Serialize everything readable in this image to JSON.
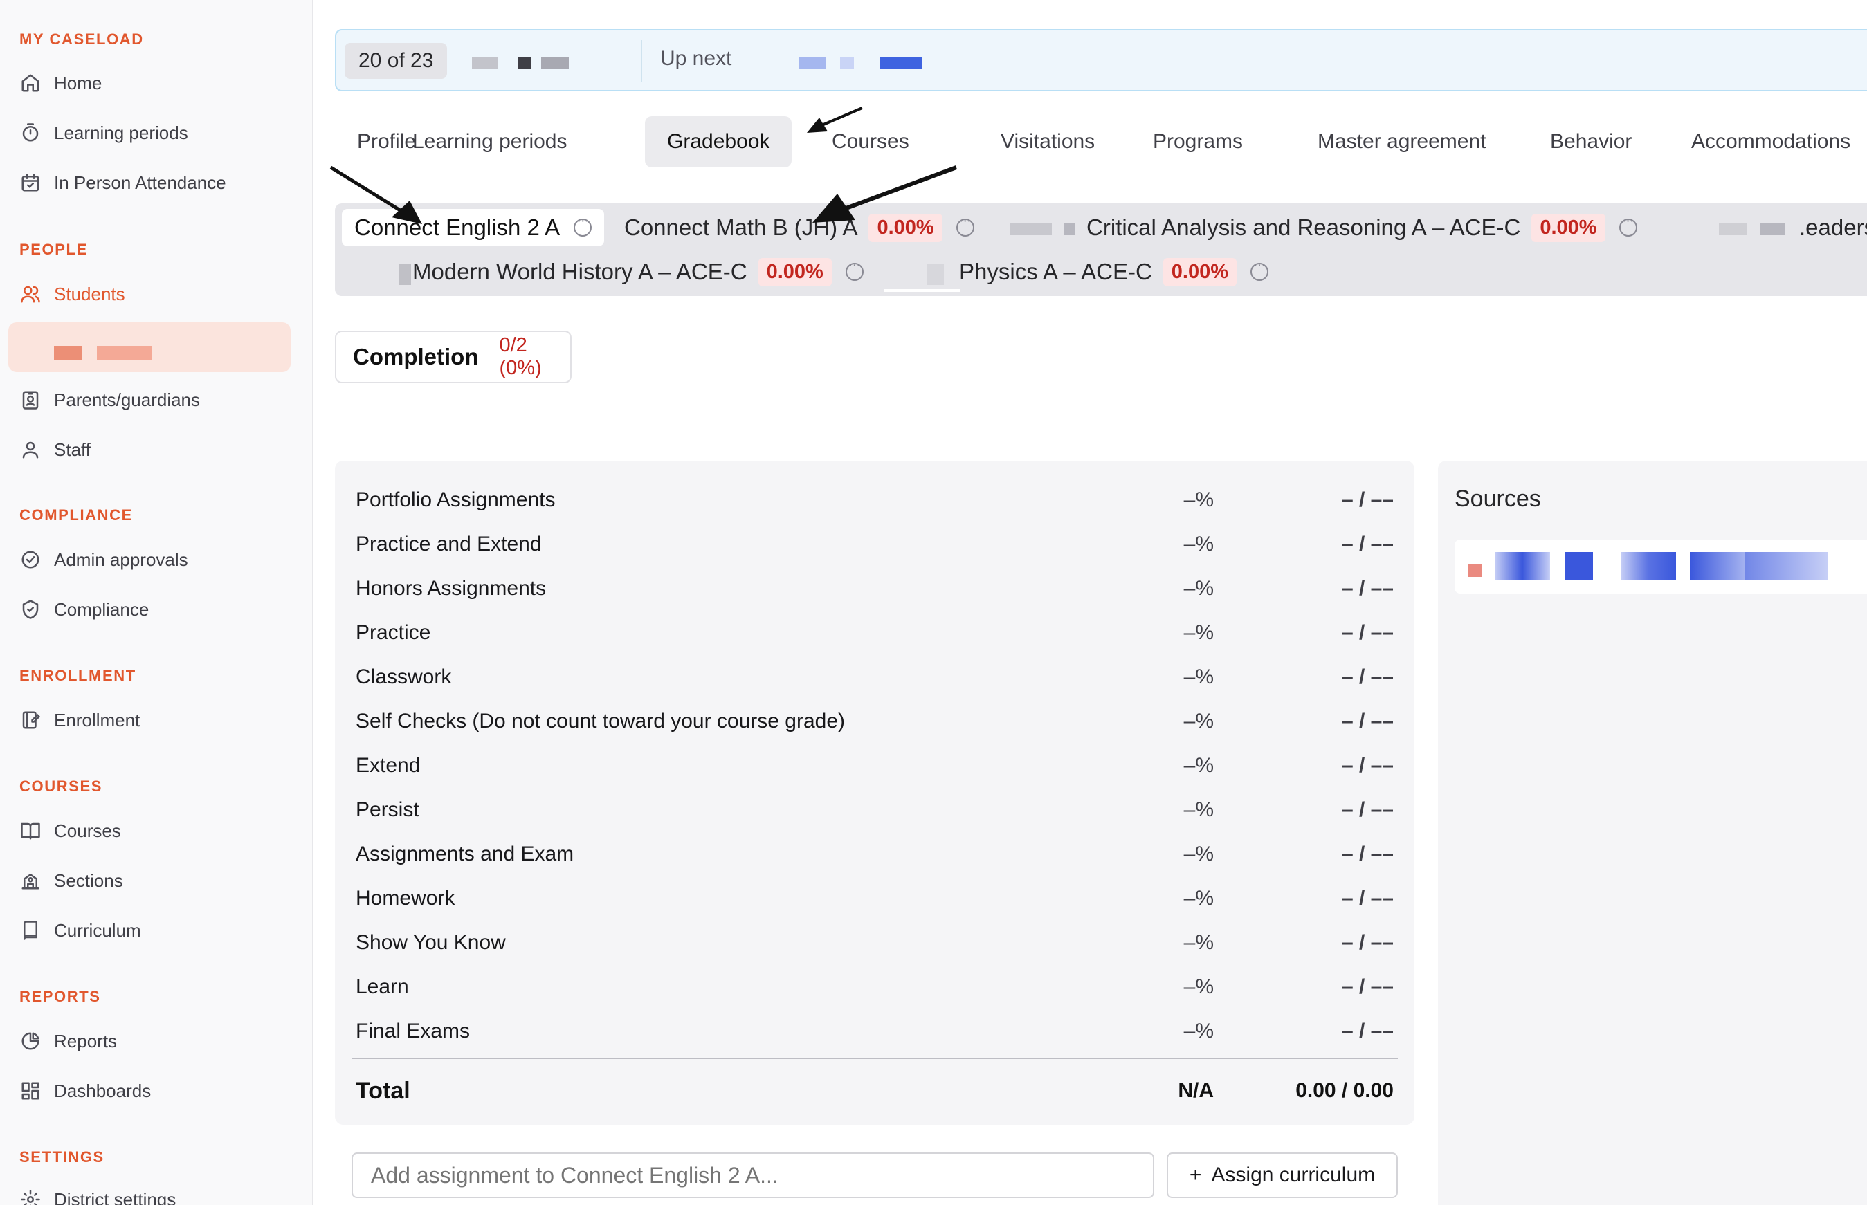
{
  "sidebar": {
    "caseload_heading": "MY CASELOAD",
    "caseload": [
      {
        "label": "Home",
        "icon": "home-icon"
      },
      {
        "label": "Learning periods",
        "icon": "timer-icon"
      },
      {
        "label": "In Person Attendance",
        "icon": "calendar-check-icon"
      }
    ],
    "people_heading": "PEOPLE",
    "people": [
      {
        "label": "Students",
        "icon": "users-icon"
      },
      {
        "label": "Parents/guardians",
        "icon": "id-badge-icon"
      },
      {
        "label": "Staff",
        "icon": "user-icon"
      }
    ],
    "compliance_heading": "COMPLIANCE",
    "compliance": [
      {
        "label": "Admin approvals",
        "icon": "check-circle-icon"
      },
      {
        "label": "Compliance",
        "icon": "shield-check-icon"
      }
    ],
    "enrollment_heading": "ENROLLMENT",
    "enrollment": [
      {
        "label": "Enrollment",
        "icon": "notebook-pen-icon"
      }
    ],
    "courses_heading": "COURSES",
    "courses": [
      {
        "label": "Courses",
        "icon": "book-open-icon"
      },
      {
        "label": "Sections",
        "icon": "school-icon"
      },
      {
        "label": "Curriculum",
        "icon": "book-icon"
      }
    ],
    "reports_heading": "REPORTS",
    "reports": [
      {
        "label": "Reports",
        "icon": "pie-chart-icon"
      },
      {
        "label": "Dashboards",
        "icon": "dashboard-icon"
      }
    ],
    "settings_heading": "SETTINGS",
    "settings": [
      {
        "label": "District settings",
        "icon": "gear-icon"
      }
    ]
  },
  "banner": {
    "counter": "20 of 23",
    "up_next": "Up next"
  },
  "tabs": [
    "Profile",
    "Learning periods",
    "Gradebook",
    "Courses",
    "Visitations",
    "Programs",
    "Master agreement",
    "Behavior",
    "Accommodations"
  ],
  "active_tab": "Gradebook",
  "course_tabs": {
    "active": "Connect English 2 A",
    "math": {
      "name": "Connect Math B (JH) A",
      "pct": "0.00%"
    },
    "critical": {
      "name": "Critical Analysis and Reasoning A – ACE-C",
      "pct": "0.00%"
    },
    "leadership_partial": ".eadersh",
    "history": {
      "name": "Modern World History A – ACE-C",
      "pct": "0.00%"
    },
    "physics": {
      "name": "Physics A – ACE-C",
      "pct": "0.00%"
    }
  },
  "completion": {
    "label": "Completion",
    "value": "0/2 (0%)"
  },
  "gradebook": {
    "rows": [
      {
        "name": "Portfolio Assignments",
        "pct": "–%",
        "score": "– / ––"
      },
      {
        "name": "Practice and Extend",
        "pct": "–%",
        "score": "– / ––"
      },
      {
        "name": "Honors Assignments",
        "pct": "–%",
        "score": "– / ––"
      },
      {
        "name": "Practice",
        "pct": "–%",
        "score": "– / ––"
      },
      {
        "name": "Classwork",
        "pct": "–%",
        "score": "– / ––"
      },
      {
        "name": "Self Checks (Do not count toward your course grade)",
        "pct": "–%",
        "score": "– / ––"
      },
      {
        "name": "Extend",
        "pct": "–%",
        "score": "– / ––"
      },
      {
        "name": "Persist",
        "pct": "–%",
        "score": "– / ––"
      },
      {
        "name": "Assignments and Exam",
        "pct": "–%",
        "score": "– / ––"
      },
      {
        "name": "Homework",
        "pct": "–%",
        "score": "– / ––"
      },
      {
        "name": "Show You Know",
        "pct": "–%",
        "score": "– / ––"
      },
      {
        "name": "Learn",
        "pct": "–%",
        "score": "– / ––"
      },
      {
        "name": "Final Exams",
        "pct": "–%",
        "score": "– / ––"
      }
    ],
    "total": {
      "name": "Total",
      "pct": "N/A",
      "score": "0.00 / 0.00"
    }
  },
  "sources": {
    "title": "Sources"
  },
  "add_assignment": {
    "placeholder": "Add assignment to Connect English 2 A..."
  },
  "assign_curriculum": {
    "label": "Assign curriculum",
    "icon": "plus-icon"
  },
  "colors": {
    "accent": "#e1572d",
    "danger": "#c2261f",
    "banner_bg": "#eef6fc"
  }
}
